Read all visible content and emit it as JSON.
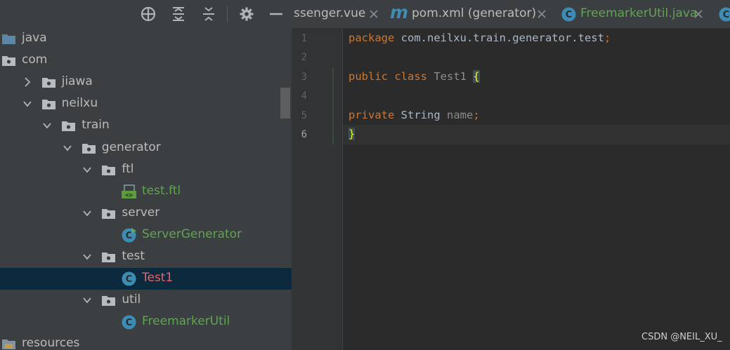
{
  "toolbar": {
    "buttons": [
      "crosshair-icon",
      "expand-all-icon",
      "collapse-all-icon",
      "gear-icon",
      "hide-icon"
    ]
  },
  "tree": {
    "items": [
      {
        "label": "java",
        "icon": "source-folder-icon",
        "chevron": "none",
        "color": "default"
      },
      {
        "label": "com",
        "icon": "package-icon",
        "chevron": "down",
        "color": "default"
      },
      {
        "label": "jiawa",
        "icon": "package-icon",
        "chevron": "right",
        "color": "default"
      },
      {
        "label": "neilxu",
        "icon": "package-icon",
        "chevron": "down",
        "color": "default"
      },
      {
        "label": "train",
        "icon": "package-icon",
        "chevron": "down",
        "color": "default"
      },
      {
        "label": "generator",
        "icon": "package-icon",
        "chevron": "down",
        "color": "default"
      },
      {
        "label": "ftl",
        "icon": "package-icon",
        "chevron": "down",
        "color": "default"
      },
      {
        "label": "test.ftl",
        "icon": "ftl-file-icon",
        "chevron": "none",
        "color": "green"
      },
      {
        "label": "server",
        "icon": "package-icon",
        "chevron": "down",
        "color": "default"
      },
      {
        "label": "ServerGenerator",
        "icon": "runnable-class-icon",
        "chevron": "none",
        "color": "green"
      },
      {
        "label": "test",
        "icon": "package-icon",
        "chevron": "down",
        "color": "default"
      },
      {
        "label": "Test1",
        "icon": "class-icon",
        "chevron": "none",
        "color": "red",
        "selected": true
      },
      {
        "label": "util",
        "icon": "package-icon",
        "chevron": "down",
        "color": "default"
      },
      {
        "label": "FreemarkerUtil",
        "icon": "class-icon",
        "chevron": "none",
        "color": "green"
      },
      {
        "label": "resources",
        "icon": "resources-folder-icon",
        "chevron": "none",
        "color": "default"
      }
    ]
  },
  "tabs": [
    {
      "label": "ssenger.vue",
      "icon": "vue-icon",
      "color": "default"
    },
    {
      "label": "pom.xml (generator)",
      "icon": "maven-icon",
      "icon_text": "m",
      "color": "default"
    },
    {
      "label": "FreemarkerUtil.java",
      "icon": "class-icon",
      "color": "green"
    },
    {
      "label": "",
      "icon": "class-icon",
      "color": "default"
    }
  ],
  "editor": {
    "line_numbers": [
      "1",
      "2",
      "3",
      "4",
      "5",
      "6"
    ],
    "current_line": "6",
    "lines": [
      {
        "tokens": [
          {
            "t": "package ",
            "c": "kw"
          },
          {
            "t": "com.neilxu.train.generator.test",
            "c": "pl"
          },
          {
            "t": ";",
            "c": "kw"
          }
        ]
      },
      {
        "tokens": []
      },
      {
        "tokens": [
          {
            "t": "public ",
            "c": "kw"
          },
          {
            "t": "class ",
            "c": "kw"
          },
          {
            "t": "Test1 ",
            "c": "grey"
          },
          {
            "t": "{",
            "c": "brace"
          }
        ]
      },
      {
        "tokens": []
      },
      {
        "tokens": [
          {
            "t": "private ",
            "c": "kw"
          },
          {
            "t": "String ",
            "c": "pl"
          },
          {
            "t": "name",
            "c": "grey"
          },
          {
            "t": ";",
            "c": "kw"
          }
        ]
      },
      {
        "tokens": [
          {
            "t": "}",
            "c": "brace"
          }
        ]
      }
    ]
  },
  "watermark": "CSDN @NEIL_XU_",
  "colors": {
    "panel_bg": "#3c3f41",
    "editor_bg": "#2b2b2b",
    "selection": "#0d293e",
    "keyword": "#cc7832",
    "vcs_added": "#62a254",
    "vcs_error": "#e5646a",
    "class_icon": "#3d8cb3"
  }
}
